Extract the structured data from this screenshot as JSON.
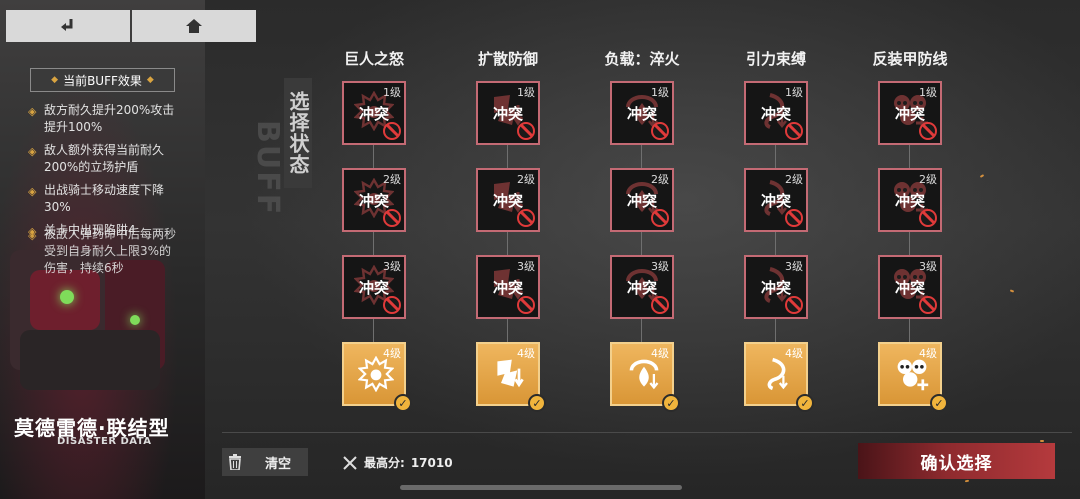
{
  "nav": {
    "back_icon": "return-arrow-icon",
    "home_icon": "home-icon"
  },
  "buff_panel": {
    "title": "当前BUFF效果",
    "items": [
      "敌方耐久提升200%攻击提升100%",
      "敌人额外获得当前耐久200%的立场护盾",
      "出战骑士移动速度下降30%",
      "关卡中出现陷阱4"
    ],
    "overlap_item": "被敌人弹药命中后每两秒受到自身耐久上限3%的伤害，持续6秒"
  },
  "mech": {
    "name": "莫德雷德·联结型",
    "subtitle": "DISASTER DATA"
  },
  "header": {
    "vertical_label": "选择状态",
    "ghost_label": "BUFF"
  },
  "columns": [
    {
      "title": "巨人之怒",
      "icon": "fist-burst-icon"
    },
    {
      "title": "扩散防御",
      "icon": "shield-shatter-icon"
    },
    {
      "title": "负载：淬火",
      "icon": "flame-ring-icon"
    },
    {
      "title": "引力束缚",
      "icon": "gravity-swirl-icon"
    },
    {
      "title": "反装甲防线",
      "icon": "skulls-plus-icon"
    }
  ],
  "levels": [
    "1级",
    "2级",
    "3级",
    "4级"
  ],
  "conflict_label": "冲突",
  "bottom": {
    "clear_label": "清空",
    "score_label": "最高分:",
    "score_value": "17010",
    "confirm_label": "确认选择"
  },
  "colors": {
    "accent_gold": "#e8a847",
    "conflict_border": "#c46a74",
    "confirm_red": "#a8373a"
  }
}
